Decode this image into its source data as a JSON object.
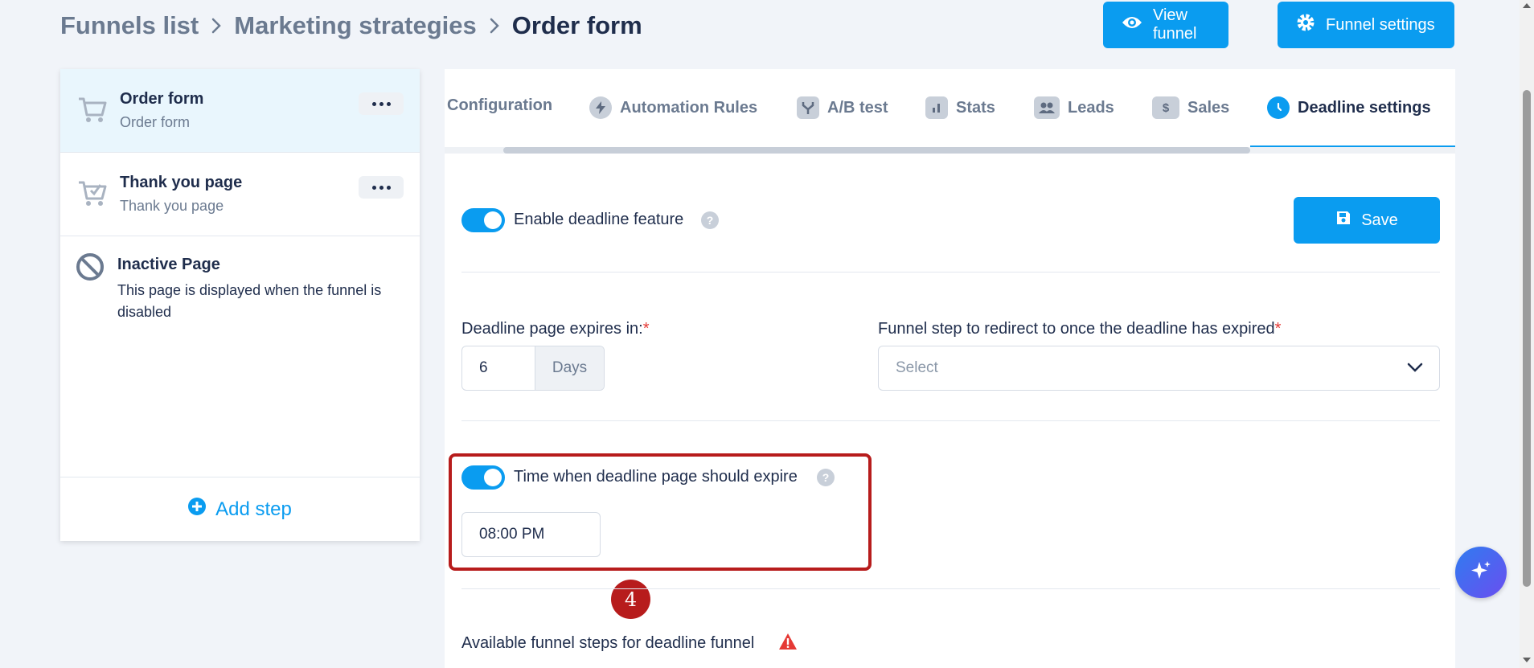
{
  "breadcrumb": {
    "items": [
      "Funnels list",
      "Marketing strategies",
      "Order form"
    ]
  },
  "header": {
    "view_funnel": "View funnel",
    "funnel_settings": "Funnel settings"
  },
  "sidebar": {
    "steps": [
      {
        "title": "Order form",
        "subtitle": "Order form"
      },
      {
        "title": "Thank you page",
        "subtitle": "Thank you page"
      }
    ],
    "inactive": {
      "title": "Inactive Page",
      "description": "This page is displayed when the funnel is disabled"
    },
    "add_step": "Add step"
  },
  "tabs": [
    {
      "label": "Configuration"
    },
    {
      "label": "Automation Rules"
    },
    {
      "label": "A/B test"
    },
    {
      "label": "Stats"
    },
    {
      "label": "Leads"
    },
    {
      "label": "Sales"
    },
    {
      "label": "Deadline settings"
    }
  ],
  "deadline": {
    "enable_label": "Enable deadline feature",
    "save": "Save",
    "expires_label": "Deadline page expires in:",
    "expires_value": "6",
    "expires_unit": "Days",
    "redirect_label": "Funnel step to redirect to once the deadline has expired",
    "redirect_placeholder": "Select",
    "time_label": "Time when deadline page should expire",
    "time_value": "08:00 PM",
    "available_label": "Available funnel steps for deadline funnel",
    "required_mark": "*",
    "help_mark": "?"
  },
  "annotation": {
    "step_number": "4"
  },
  "colors": {
    "accent": "#0a9cf0",
    "highlight": "#b71c1c",
    "text": "#1f2d4c",
    "muted": "#6b7a90"
  }
}
